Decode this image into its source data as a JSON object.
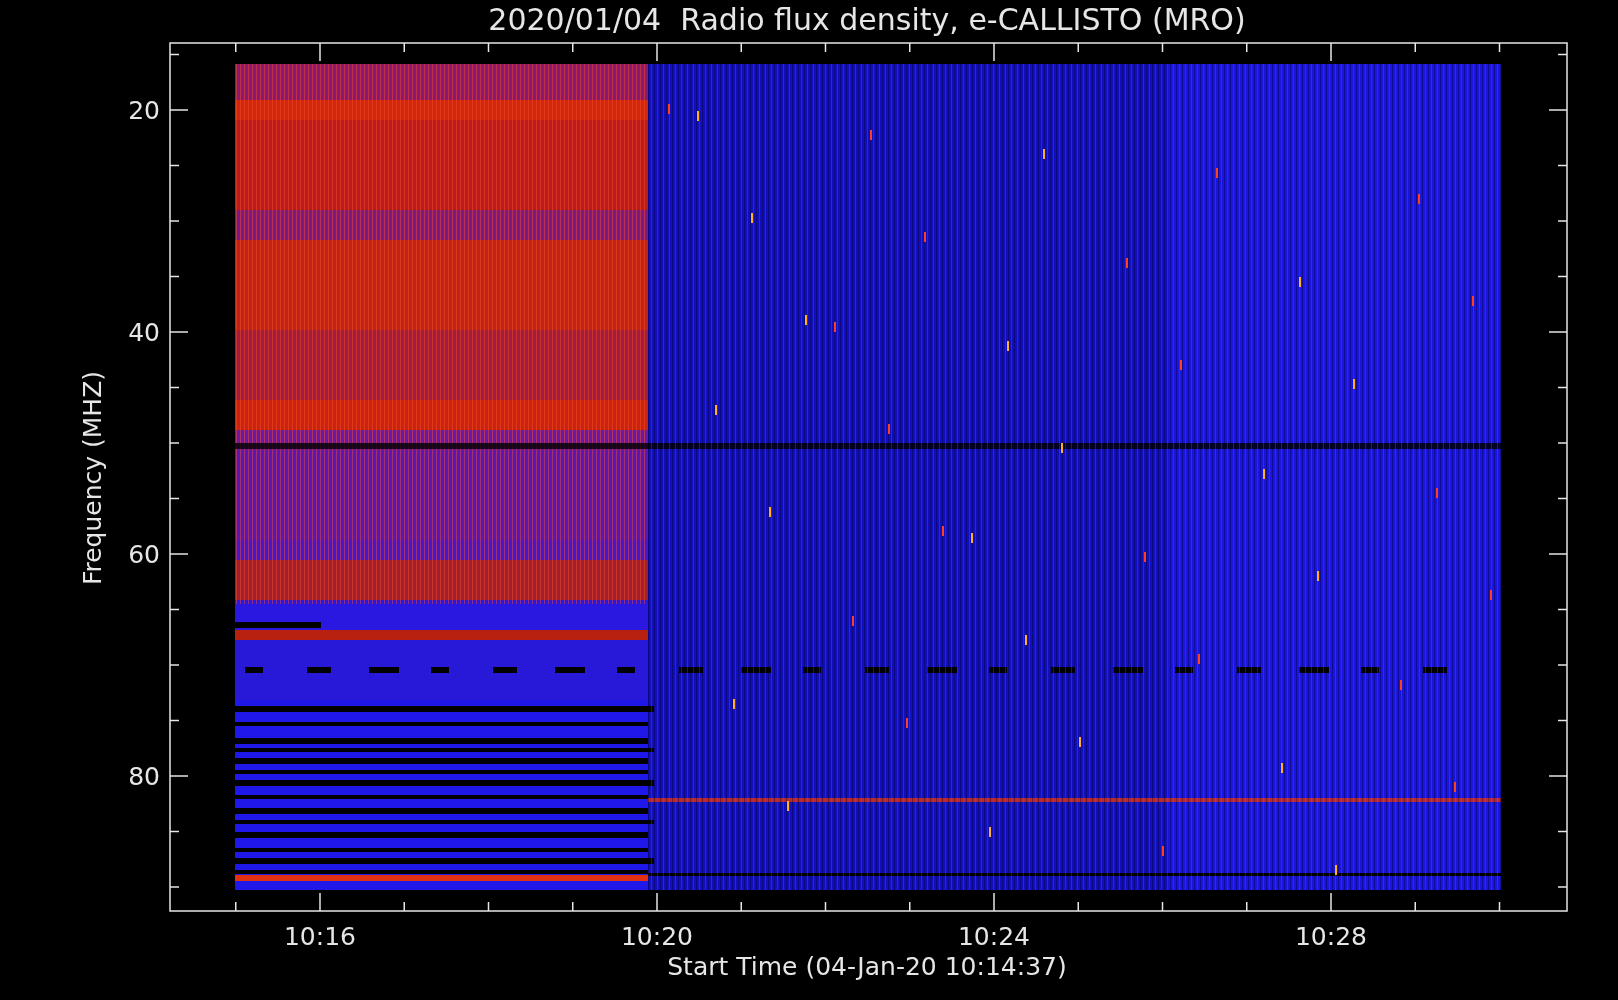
{
  "title": "2020/01/04  Radio flux density, e-CALLISTO (MRO)",
  "y_axis": {
    "label": "Frequency (MHZ)",
    "ticks": [
      "20",
      "40",
      "60",
      "80"
    ]
  },
  "x_axis": {
    "label": "Start Time (04-Jan-20 10:14:37)",
    "ticks": [
      "10:16",
      "10:20",
      "10:24",
      "10:28"
    ]
  }
}
